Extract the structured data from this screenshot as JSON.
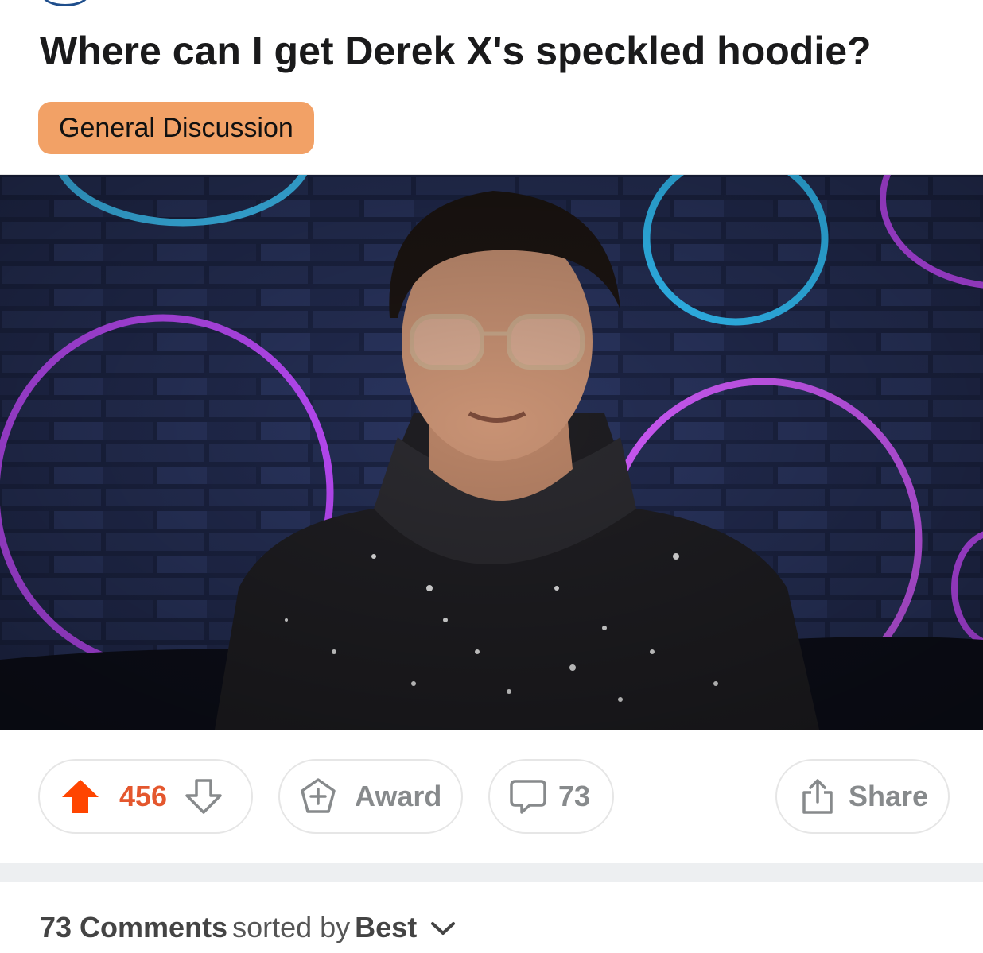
{
  "post": {
    "title": "Where can I get Derek X's speckled hoodie?",
    "flair": "General Discussion",
    "flair_color": "#f2a166"
  },
  "actions": {
    "score": "456",
    "award_label": "Award",
    "comment_count": "73",
    "share_label": "Share"
  },
  "comments_header": {
    "count_label": "73 Comments",
    "sorted_by_label": "sorted by",
    "sort_value": "Best"
  },
  "colors": {
    "upvote_active": "#ff4500",
    "score_active": "#e4572e",
    "muted": "#878a8c"
  },
  "icons": [
    "upvote-arrow-icon",
    "downvote-arrow-icon",
    "award-icon",
    "comment-bubble-icon",
    "share-icon",
    "chevron-down-icon"
  ]
}
